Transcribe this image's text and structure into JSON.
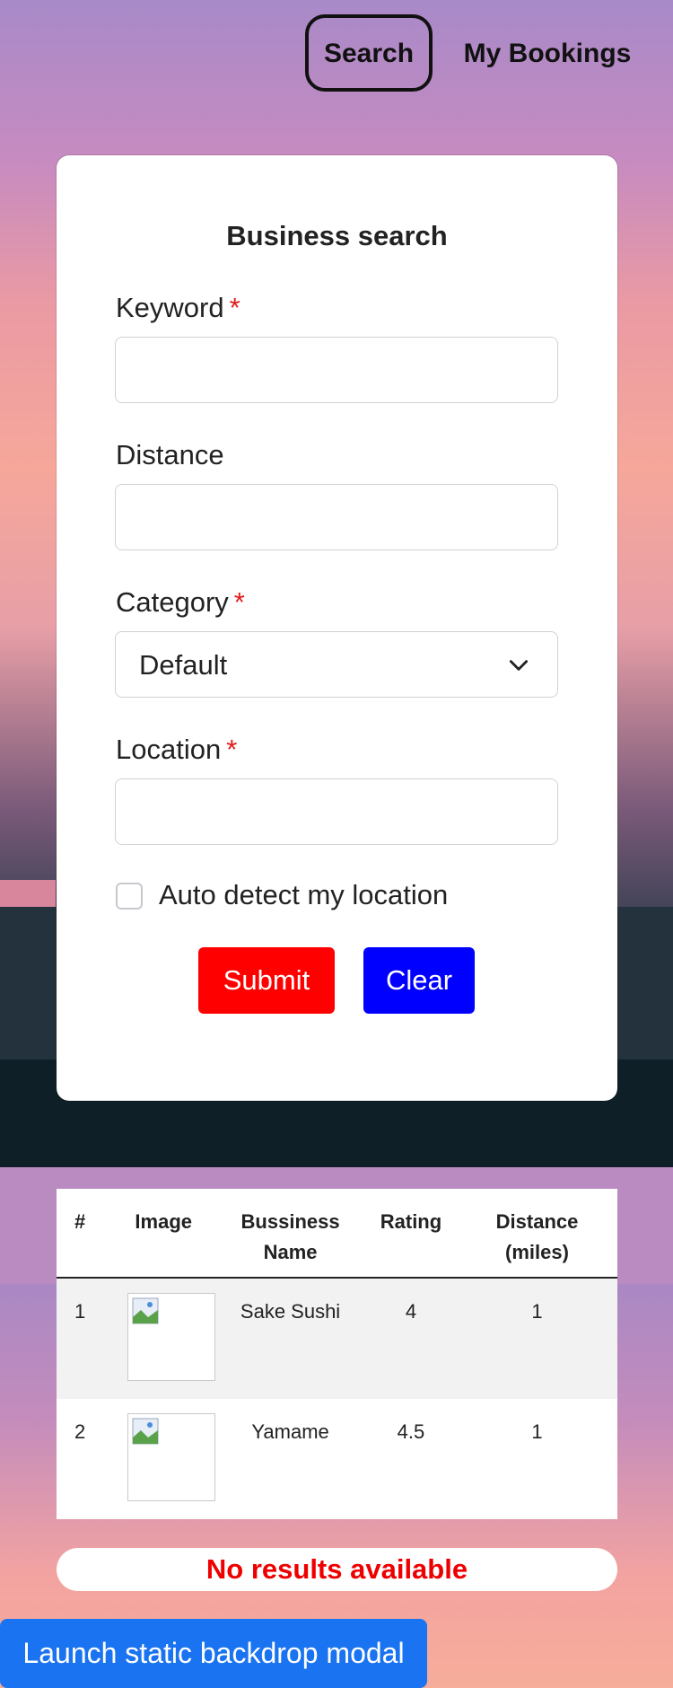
{
  "nav": {
    "search_label": "Search",
    "bookings_label": "My Bookings"
  },
  "form": {
    "title": "Business search",
    "keyword_label": "Keyword",
    "distance_label": "Distance",
    "category_label": "Category",
    "category_selected": "Default",
    "location_label": "Location",
    "required_mark": "*",
    "autodetect_label": "Auto detect my location",
    "submit_label": "Submit",
    "clear_label": "Clear"
  },
  "table": {
    "headers": [
      "#",
      "Image",
      "Bussiness Name",
      "Rating",
      "Distance (miles)"
    ],
    "rows": [
      {
        "num": "1",
        "name": "Sake Sushi",
        "rating": "4",
        "distance": "1"
      },
      {
        "num": "2",
        "name": "Yamame",
        "rating": "4.5",
        "distance": "1"
      }
    ]
  },
  "no_results": "No results available",
  "launch_button": "Launch static backdrop modal",
  "colors": {
    "submit": "#ff0000",
    "clear": "#0000ff",
    "launch": "#1a73f0",
    "no_results_text": "#ee0000",
    "required": "#e01b1b"
  }
}
